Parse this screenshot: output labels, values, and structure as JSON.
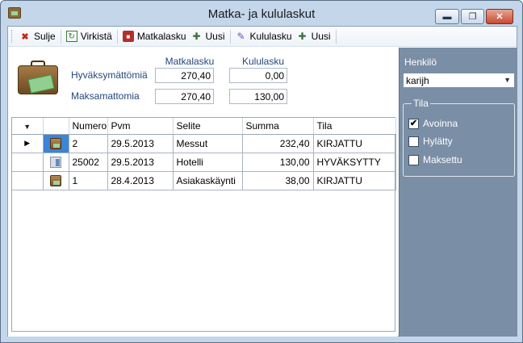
{
  "window": {
    "title": "Matka- ja kululaskut",
    "minimize_glyph": "▬",
    "maximize_glyph": "❐",
    "close_glyph": "✕"
  },
  "toolbar": {
    "close_label": "Sulje",
    "refresh_label": "Virkistä",
    "travel_label": "Matkalasku",
    "new_travel_label": "Uusi",
    "expense_label": "Kululasku",
    "new_expense_label": "Uusi"
  },
  "summary": {
    "col_travel": "Matkalasku",
    "col_expense": "Kululasku",
    "rows": [
      {
        "label": "Hyväksymättömiä",
        "travel": "270,40",
        "expense": "0,00"
      },
      {
        "label": "Maksamattomia",
        "travel": "270,40",
        "expense": "130,00"
      }
    ]
  },
  "grid": {
    "filter_glyph": "▼",
    "current_marker": "▶",
    "columns": [
      "Numero",
      "Pvm",
      "Selite",
      "Summa",
      "Tila"
    ],
    "rows": [
      {
        "type_icon": "travel-icon",
        "numero": "2",
        "pvm": "29.5.2013",
        "selite": "Messut",
        "summa": "232,40",
        "tila": "KIRJATTU"
      },
      {
        "type_icon": "expense-icon",
        "numero": "25002",
        "pvm": "29.5.2013",
        "selite": "Hotelli",
        "summa": "130,00",
        "tila": "HYVÄKSYTTY"
      },
      {
        "type_icon": "travel-icon",
        "numero": "1",
        "pvm": "28.4.2013",
        "selite": "Asiakaskäynti",
        "summa": "38,00",
        "tila": "KIRJATTU"
      }
    ]
  },
  "side": {
    "person_label": "Henkilö",
    "person_value": "karijh",
    "status_group": "Tila",
    "statuses": [
      {
        "label": "Avoinna",
        "checked": true,
        "mark": "✔"
      },
      {
        "label": "Hylätty",
        "checked": false,
        "mark": ""
      },
      {
        "label": "Maksettu",
        "checked": false,
        "mark": ""
      }
    ]
  },
  "colors": {
    "window_frame": "#c4d6ea",
    "side_panel": "#7a8ea6",
    "selection": "#3c84d6",
    "summary_label": "#24477a"
  }
}
